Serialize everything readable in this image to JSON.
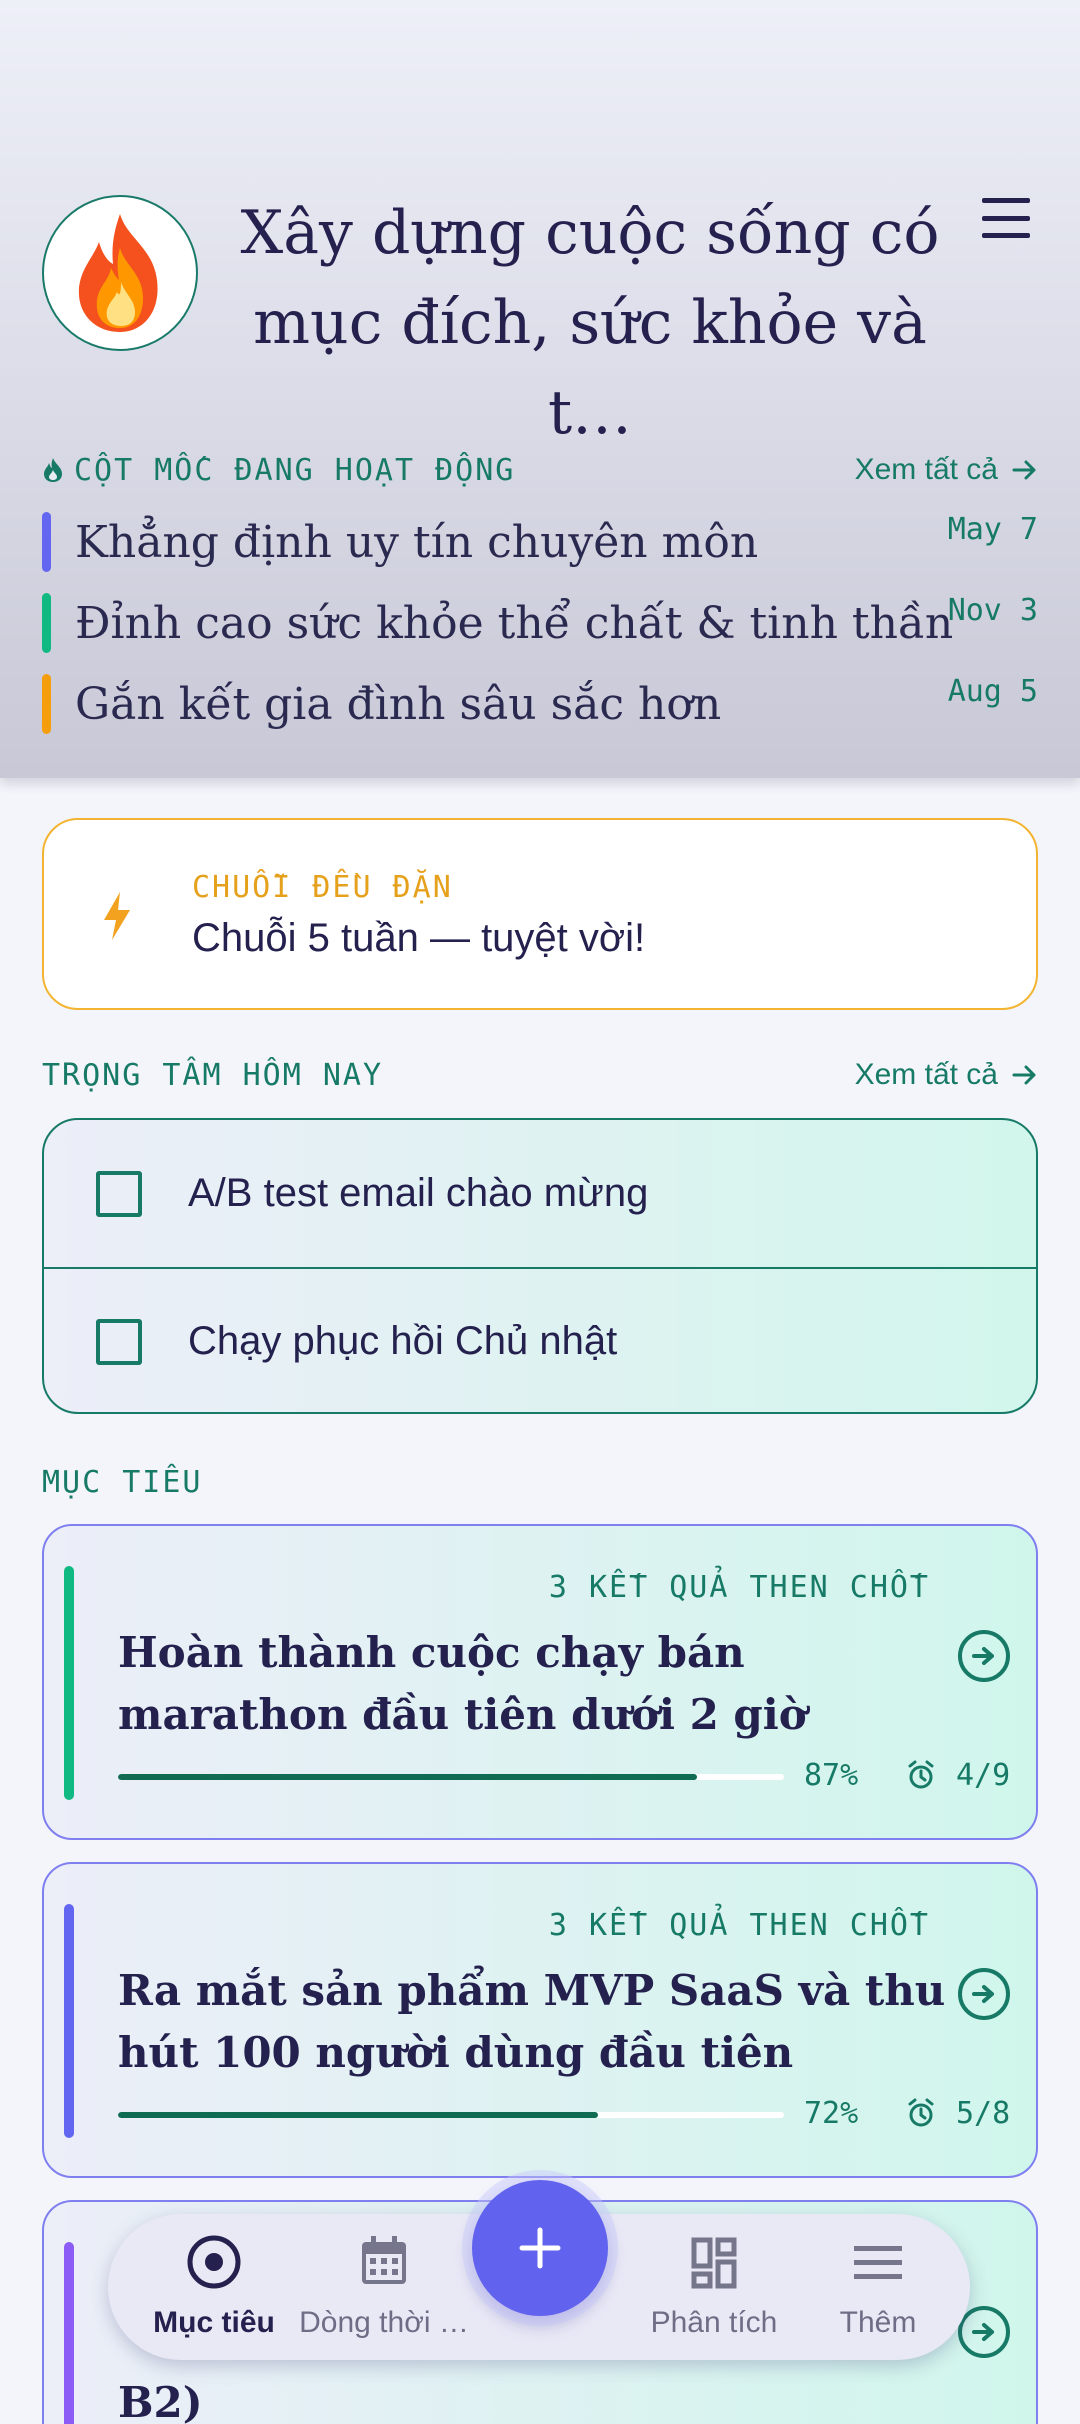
{
  "header": {
    "title": "Xây dựng cuộc sống có mục đích, sức khỏe và t…"
  },
  "milestones": {
    "section_label": "CỘT MỐC ĐANG HOẠT ĐỘNG",
    "see_all": "Xem tất cả",
    "items": [
      {
        "title": "Khẳng định uy tín chuyên môn",
        "date": "May 7",
        "color": "#6366f1"
      },
      {
        "title": "Đỉnh cao sức khỏe thể chất & tinh thần",
        "date": "Nov 3",
        "color": "#10b981"
      },
      {
        "title": "Gắn kết gia đình sâu sắc hơn",
        "date": "Aug 5",
        "color": "#f59e0b"
      }
    ]
  },
  "streak": {
    "label": "CHUỖI ĐỀU ĐẶN",
    "text": "Chuỗi 5 tuần — tuyệt vời!"
  },
  "focus": {
    "section_label": "TRỌNG TÂM HÔM NAY",
    "see_all": "Xem tất cả",
    "tasks": [
      {
        "text": "A/B test email chào mừng",
        "done": false
      },
      {
        "text": "Chạy phục hồi Chủ nhật",
        "done": false
      }
    ]
  },
  "goals": {
    "section_label": "MỤC TIÊU",
    "items": [
      {
        "key_results": "3 KẾT QUẢ THEN CHỐT",
        "title": "Hoàn thành cuộc chạy bán marathon đầu tiên dưới 2 giờ",
        "progress": 0.87,
        "progress_label": "87%",
        "count": "4/9",
        "accent": "#10b981"
      },
      {
        "key_results": "3 KẾT QUẢ THEN CHỐT",
        "title": "Ra mắt sản phẩm MVP SaaS và thu hút 100 người dùng đầu tiên",
        "progress": 0.72,
        "progress_label": "72%",
        "count": "5/8",
        "accent": "#6366f1"
      },
      {
        "key_results": "",
        "title_partial": "B2)",
        "accent": "#8b5cf6"
      }
    ]
  },
  "nav": {
    "items": [
      {
        "label": "Mục tiêu",
        "icon": "target-icon",
        "active": true
      },
      {
        "label": "Dòng thời …",
        "icon": "calendar-icon",
        "active": false
      },
      {
        "label": "Phân tích",
        "icon": "dashboard-icon",
        "active": false
      },
      {
        "label": "Thêm",
        "icon": "menu-icon",
        "active": false
      }
    ],
    "fab_icon": "plus-icon"
  },
  "colors": {
    "accent_teal": "#177a66",
    "accent_indigo": "#6163ee",
    "streak_orange": "#f2b431"
  }
}
